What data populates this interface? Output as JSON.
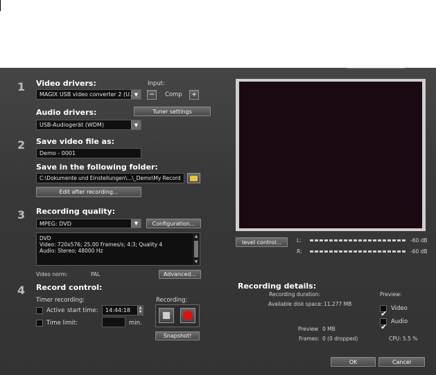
{
  "sections": {
    "s1": "1",
    "s2": "2",
    "s3": "3",
    "s4": "4"
  },
  "video_drivers": {
    "heading": "Video drivers:",
    "value": "MAGIX USB video converter 2 (U...",
    "input_label": "Input:",
    "input_value": "Comp",
    "minus": "−",
    "plus": "+"
  },
  "audio_drivers": {
    "heading": "Audio drivers:",
    "value": "USB-Audiogerät (WDM)",
    "tuner_button": "Tuner settings"
  },
  "save_file": {
    "heading": "Save video file as:",
    "value": "Demo - 0001",
    "folder_heading": "Save in the following folder:",
    "folder_value": "C:\\Dokumente und Einstellungen\\...\\_Demo\\My Record",
    "edit_button": "Edit after recording..."
  },
  "quality": {
    "heading": "Recording quality:",
    "value": "MPEG: DVD",
    "config_button": "Configuration...",
    "description": [
      "DVD",
      "Video: 720x576; 25.00 Frames/s; 4:3; Quality 4",
      "Audio: Stereo; 48000 Hz"
    ],
    "video_norm_label": "Video norm:",
    "video_norm_value": "PAL",
    "advanced_button": "Advanced..."
  },
  "record_control": {
    "heading": "Record control:",
    "timer_label": "Timer recording:",
    "active_label": "Active",
    "start_time_label": "start time:",
    "start_time_value": "14:44:18",
    "time_limit_label": "Time limit:",
    "time_limit_value": "",
    "min_label": "min.",
    "recording_label": "Recording:",
    "snapshot_button": "Snapshot!"
  },
  "levels": {
    "button": "level control...",
    "left_label": "L:",
    "right_label": "R:",
    "left_db": "-60 dB",
    "right_db": "-60 dB"
  },
  "details": {
    "heading": "Recording details:",
    "duration_label": "Recording duration:",
    "duration_value": "",
    "disk_label": "Available disk space:",
    "disk_value": "11.277 MB",
    "preview_size_label": "Preview",
    "preview_size_value": "0 MB",
    "frames_label": "Frames:",
    "frames_value": "0 (0 dropped)",
    "cpu_label": "CPU:",
    "cpu_value": "5.5 %",
    "preview_heading": "Preview:",
    "video_label": "Video",
    "audio_label": "Audio"
  },
  "footer": {
    "ok": "OK",
    "cancel": "Cancel"
  },
  "colors": {
    "dialog_bg": "#3a3a3a",
    "preview_bg": "#1a0812",
    "record_red": "#e01010"
  }
}
